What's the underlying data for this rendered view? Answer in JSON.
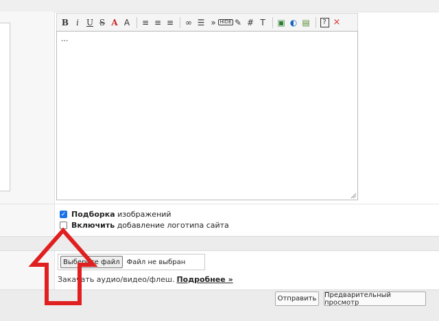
{
  "toolbar": {
    "buttons": [
      {
        "glyph": "B"
      },
      {
        "glyph": "i"
      },
      {
        "glyph": "U"
      },
      {
        "glyph": "S"
      },
      {
        "glyph": "A"
      },
      {
        "glyph": "A"
      },
      {
        "glyph": "≡"
      },
      {
        "glyph": "≡"
      },
      {
        "glyph": "≡"
      },
      {
        "glyph": "∞"
      },
      {
        "glyph": "☰"
      },
      {
        "glyph": "»"
      },
      {
        "glyph": "HIDE"
      },
      {
        "glyph": "✎"
      },
      {
        "glyph": "#"
      },
      {
        "glyph": "T"
      },
      {
        "glyph": "▣"
      },
      {
        "glyph": "◐"
      },
      {
        "glyph": "▤"
      },
      {
        "glyph": "?"
      },
      {
        "glyph": "×"
      }
    ],
    "accent_red": "#c62828"
  },
  "editor": {
    "content": "..."
  },
  "options": {
    "gallery_bold": "Подборка",
    "gallery_rest": " изображений",
    "gallery_checked": true,
    "logo_bold": "Включить",
    "logo_rest": " добавление логотипа сайта",
    "logo_checked": false
  },
  "upload": {
    "choose_button": "Выберите файл",
    "no_file": "Файл не выбран",
    "media_text": "Закачать аудио/видео/флеш.",
    "more_link": "Подробнее »"
  },
  "actions": {
    "submit": "Отправить",
    "preview": "Предварительный просмотр"
  },
  "annotation": {
    "arrow_color": "#e02020"
  }
}
